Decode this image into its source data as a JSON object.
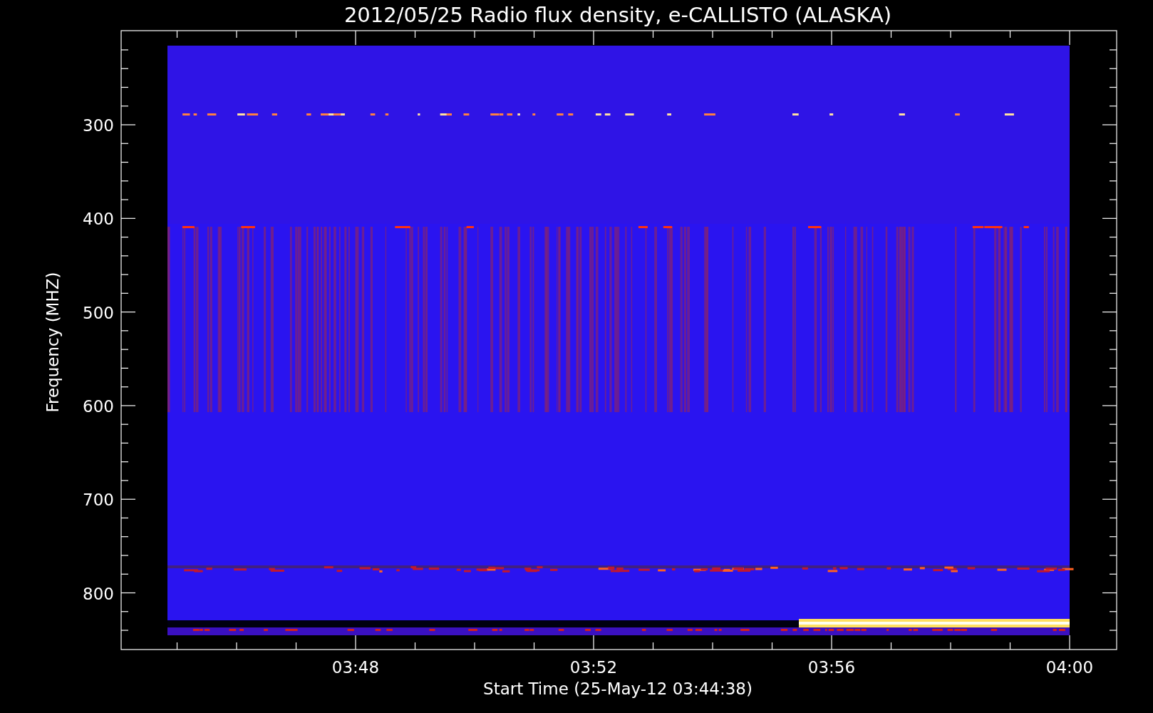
{
  "title": "2012/05/25  Radio flux density, e-CALLISTO (ALASKA)",
  "x_axis": {
    "label": "Start Time (25-May-12 03:44:38)",
    "ticks": [
      "03:48",
      "03:52",
      "03:56",
      "04:00"
    ]
  },
  "y_axis": {
    "label": "Frequency (MHZ)",
    "ticks": [
      "300",
      "400",
      "500",
      "600",
      "700",
      "800"
    ]
  }
}
